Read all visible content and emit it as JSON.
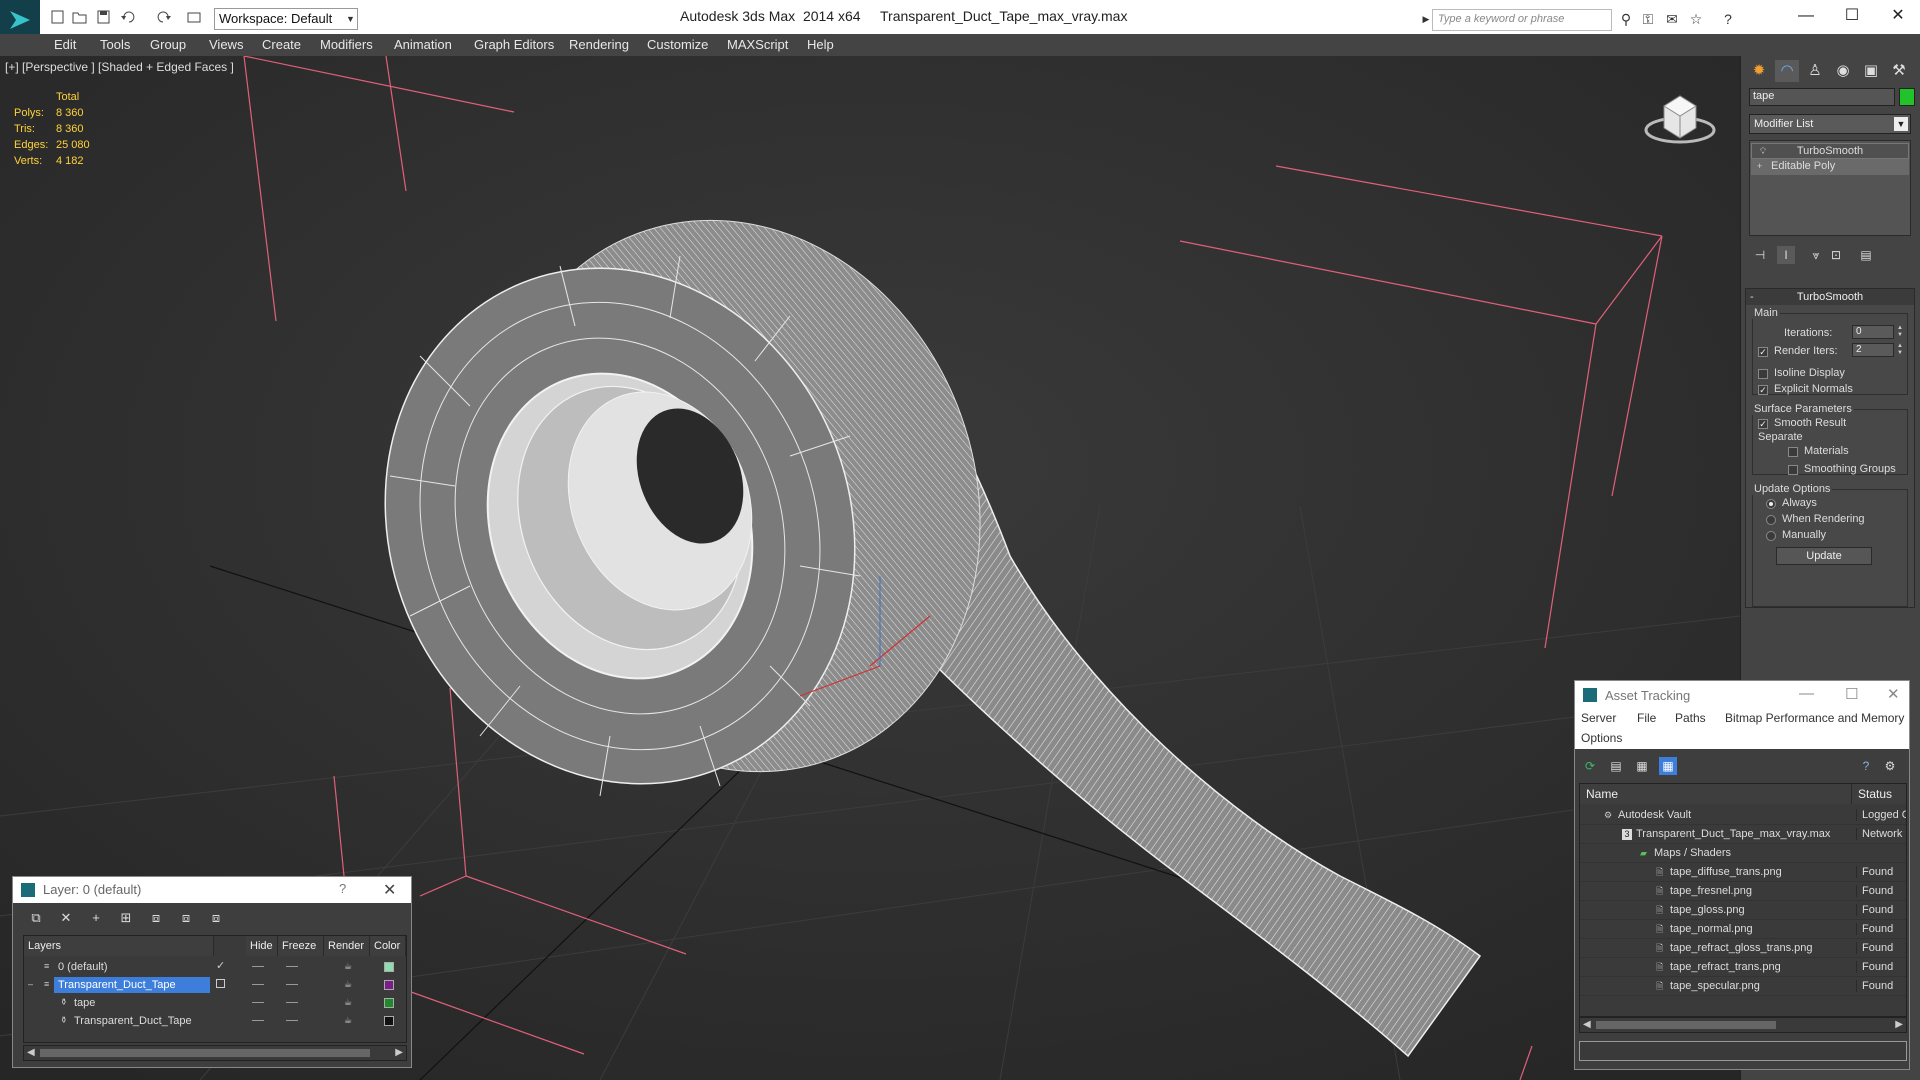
{
  "titlebar": {
    "workspace": "Workspace: Default",
    "app_title": "Autodesk 3ds Max  2014 x64",
    "file_title": "Transparent_Duct_Tape_max_vray.max",
    "search_placeholder": "Type a keyword or phrase"
  },
  "menu": [
    "Edit",
    "Tools",
    "Group",
    "Views",
    "Create",
    "Modifiers",
    "Animation",
    "Graph Editors",
    "Rendering",
    "Customize",
    "MAXScript",
    "Help"
  ],
  "viewport": {
    "label": "[+] [Perspective ] [Shaded + Edged Faces ]",
    "stats": {
      "header": "Total",
      "rows": [
        {
          "label": "Polys:",
          "value": "8 360"
        },
        {
          "label": "Tris:",
          "value": "8 360"
        },
        {
          "label": "Edges:",
          "value": "25 080"
        },
        {
          "label": "Verts:",
          "value": "4 182"
        }
      ]
    }
  },
  "command_panel": {
    "object_name": "tape",
    "object_color": "#22c22a",
    "modifier_list": "Modifier List",
    "stack": [
      "TurboSmooth",
      "Editable Poly"
    ],
    "rollout_title": "TurboSmooth",
    "main_group": "Main",
    "iterations_label": "Iterations:",
    "iterations_value": "0",
    "render_iters_label": "Render Iters:",
    "render_iters_value": "2",
    "isoline_label": "Isoline Display",
    "explicit_normals_label": "Explicit Normals",
    "surface_group": "Surface Parameters",
    "smooth_result_label": "Smooth Result",
    "separate_label": "Separate",
    "materials_label": "Materials",
    "smoothing_groups_label": "Smoothing Groups",
    "update_group": "Update Options",
    "always_label": "Always",
    "when_rendering_label": "When Rendering",
    "manually_label": "Manually",
    "update_button": "Update"
  },
  "layer_dialog": {
    "title": "Layer: 0 (default)",
    "help": "?",
    "columns": [
      "Layers",
      "Hide",
      "Freeze",
      "Render",
      "Color"
    ],
    "rows": [
      {
        "name": "0 (default)",
        "color": "#8fdcb0"
      },
      {
        "name": "Transparent_Duct_Tape",
        "color": "#7a1f8a"
      },
      {
        "name": "tape",
        "color": "#1f8a2a"
      },
      {
        "name": "Transparent_Duct_Tape",
        "color": "#111111"
      }
    ]
  },
  "asset_tracking": {
    "title": "Asset Tracking",
    "menu": [
      "Server",
      "File",
      "Paths",
      "Bitmap Performance and Memory",
      "Options"
    ],
    "columns": [
      "Name",
      "Status"
    ],
    "rows": [
      {
        "name": "Autodesk Vault",
        "status": "Logged Out"
      },
      {
        "name": "Transparent_Duct_Tape_max_vray.max",
        "status": "Network Path"
      },
      {
        "name": "Maps / Shaders",
        "status": ""
      },
      {
        "name": "tape_diffuse_trans.png",
        "status": "Found"
      },
      {
        "name": "tape_fresnel.png",
        "status": "Found"
      },
      {
        "name": "tape_gloss.png",
        "status": "Found"
      },
      {
        "name": "tape_normal.png",
        "status": "Found"
      },
      {
        "name": "tape_refract_gloss_trans.png",
        "status": "Found"
      },
      {
        "name": "tape_refract_trans.png",
        "status": "Found"
      },
      {
        "name": "tape_specular.png",
        "status": "Found"
      }
    ]
  }
}
